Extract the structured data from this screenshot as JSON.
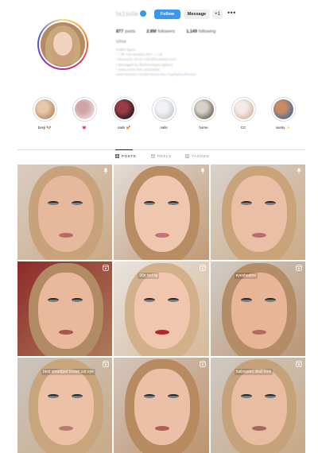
{
  "profile": {
    "username": "ta1sslw",
    "follow_label": "Follow",
    "message_label": "Message",
    "suggest_label": "+1",
    "more_label": "•••",
    "stats": [
      {
        "count": "877",
        "label": "posts"
      },
      {
        "count": "2.8M",
        "label": "followers"
      },
      {
        "count": "1,149",
        "label": "following"
      }
    ],
    "display_name": "Ulse",
    "bio_lines": [
      "Public figure",
      "♡ Tik Tok tanaslw 3M+ ☆ UK",
      "• Business 16 M • info@business.com",
      "• Managed by @ohmymgmt agency",
      "• www.some.link.co/tanaslw",
      "www.website.com/products/ulse-highlightcollection"
    ]
  },
  "highlights": [
    {
      "label": "benji 🐶",
      "color1": "#b78e6e",
      "color2": "#e7c7a8"
    },
    {
      "label": "💗",
      "color1": "#e8d6d2",
      "color2": "#cfa2a6"
    },
    {
      "label": "nails 💅",
      "color1": "#2c1e1e",
      "color2": "#9b3b45"
    },
    {
      "label": "nails",
      "color1": "#c9ced4",
      "color2": "#f1f2f4"
    },
    {
      "label": "home",
      "color1": "#7a6d62",
      "color2": "#d6d1c9"
    },
    {
      "label": "CC",
      "color1": "#d9b9a5",
      "color2": "#f3ebe7"
    },
    {
      "label": "vanity ✨",
      "color1": "#4d6f95",
      "color2": "#c88b63"
    }
  ],
  "tabs": [
    {
      "label": "POSTS",
      "icon": "grid-icon",
      "active": true
    },
    {
      "label": "REELS",
      "icon": "reels-icon",
      "active": false
    },
    {
      "label": "TAGGED",
      "icon": "tag-icon",
      "active": false
    }
  ],
  "posts": [
    {
      "caption": "",
      "badge": "pin-icon",
      "skin": "#e7b99c",
      "hair": "#c7a27a",
      "bg": "#d9cdc2",
      "lips": "#b56a66"
    },
    {
      "caption": "",
      "badge": "pin-icon",
      "skin": "#efc6ae",
      "hair": "#b88d63",
      "bg": "#e3dcd6",
      "lips": "#c4737a"
    },
    {
      "caption": "",
      "badge": "pin-icon",
      "skin": "#ebbfa5",
      "hair": "#c9a379",
      "bg": "#d8d2cc",
      "lips": "#b56d6f"
    },
    {
      "caption": "",
      "badge": "reel-icon",
      "skin": "#eab89b",
      "hair": "#b18b63",
      "bg": "#8e2a2a",
      "lips": "#a9544f"
    },
    {
      "caption": "90s red lip",
      "badge": "reel-icon",
      "skin": "#f0c7ae",
      "hair": "#d2b08a",
      "bg": "#e9e3df",
      "lips": "#b4242c"
    },
    {
      "caption": "eyeshadow",
      "badge": "reel-icon",
      "skin": "#e8b597",
      "hair": "#b48c66",
      "bg": "#d2ccc6",
      "lips": "#b36a62"
    },
    {
      "caption": "best smudged brown cat eye",
      "badge": "reel-icon",
      "skin": "#ecc1a5",
      "hair": "#c8a57c",
      "bg": "#cbc5bf",
      "lips": "#b87a73"
    },
    {
      "caption": "",
      "badge": "reel-icon",
      "skin": "#ecc0a6",
      "hair": "#b78a60",
      "bg": "#d5c6bb",
      "lips": "#b25c5c"
    },
    {
      "caption": "halloween skull look",
      "badge": "reel-icon",
      "skin": "#e9bda1",
      "hair": "#c6a27b",
      "bg": "#cfc9c3",
      "lips": "#a7655f"
    }
  ]
}
